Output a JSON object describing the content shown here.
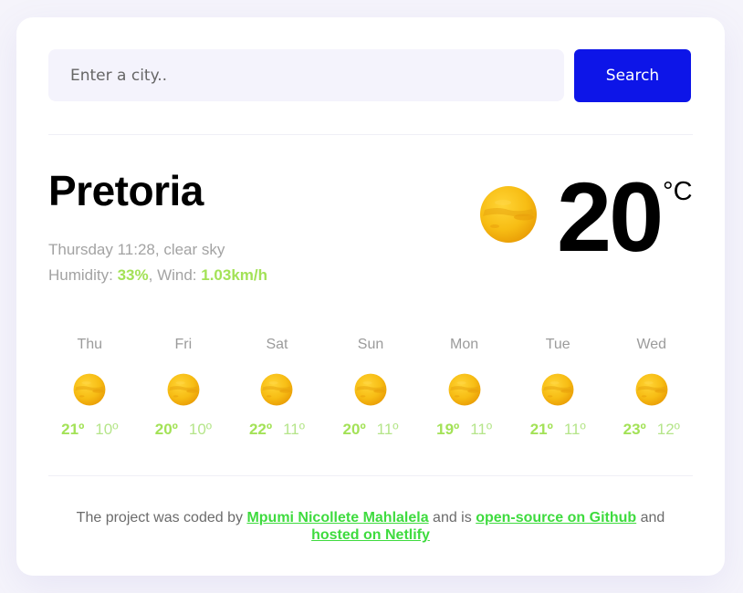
{
  "search": {
    "placeholder": "Enter a city..",
    "button_label": "Search"
  },
  "current": {
    "city": "Pretoria",
    "datetime_description": "Thursday 11:28, clear sky",
    "humidity_label": "Humidity: ",
    "humidity_value": "33%",
    "separator": ", ",
    "wind_label": "Wind: ",
    "wind_value": "1.03km/h",
    "temperature": "20",
    "unit": "°C",
    "icon": "sun-icon"
  },
  "forecast": [
    {
      "day": "Thu",
      "max": "21º",
      "min": "10º",
      "icon": "sun-icon"
    },
    {
      "day": "Fri",
      "max": "20º",
      "min": "10º",
      "icon": "sun-icon"
    },
    {
      "day": "Sat",
      "max": "22º",
      "min": "11º",
      "icon": "sun-icon"
    },
    {
      "day": "Sun",
      "max": "20º",
      "min": "11º",
      "icon": "sun-icon"
    },
    {
      "day": "Mon",
      "max": "19º",
      "min": "11º",
      "icon": "sun-icon"
    },
    {
      "day": "Tue",
      "max": "21º",
      "min": "11º",
      "icon": "sun-icon"
    },
    {
      "day": "Wed",
      "max": "23º",
      "min": "12º",
      "icon": "sun-icon"
    }
  ],
  "footer": {
    "text_1": "The project was coded by ",
    "author_link": "Mpumi Nicollete Mahlalela",
    "text_2": " and is ",
    "github_link": "open-source on Github",
    "text_3": " and ",
    "netlify_link": "hosted on Netlify"
  },
  "colors": {
    "accent": "#a3e257",
    "button": "#0d15e8",
    "link": "#3edb3e",
    "muted": "#a3a3a3",
    "background": "#f5f4fb"
  }
}
